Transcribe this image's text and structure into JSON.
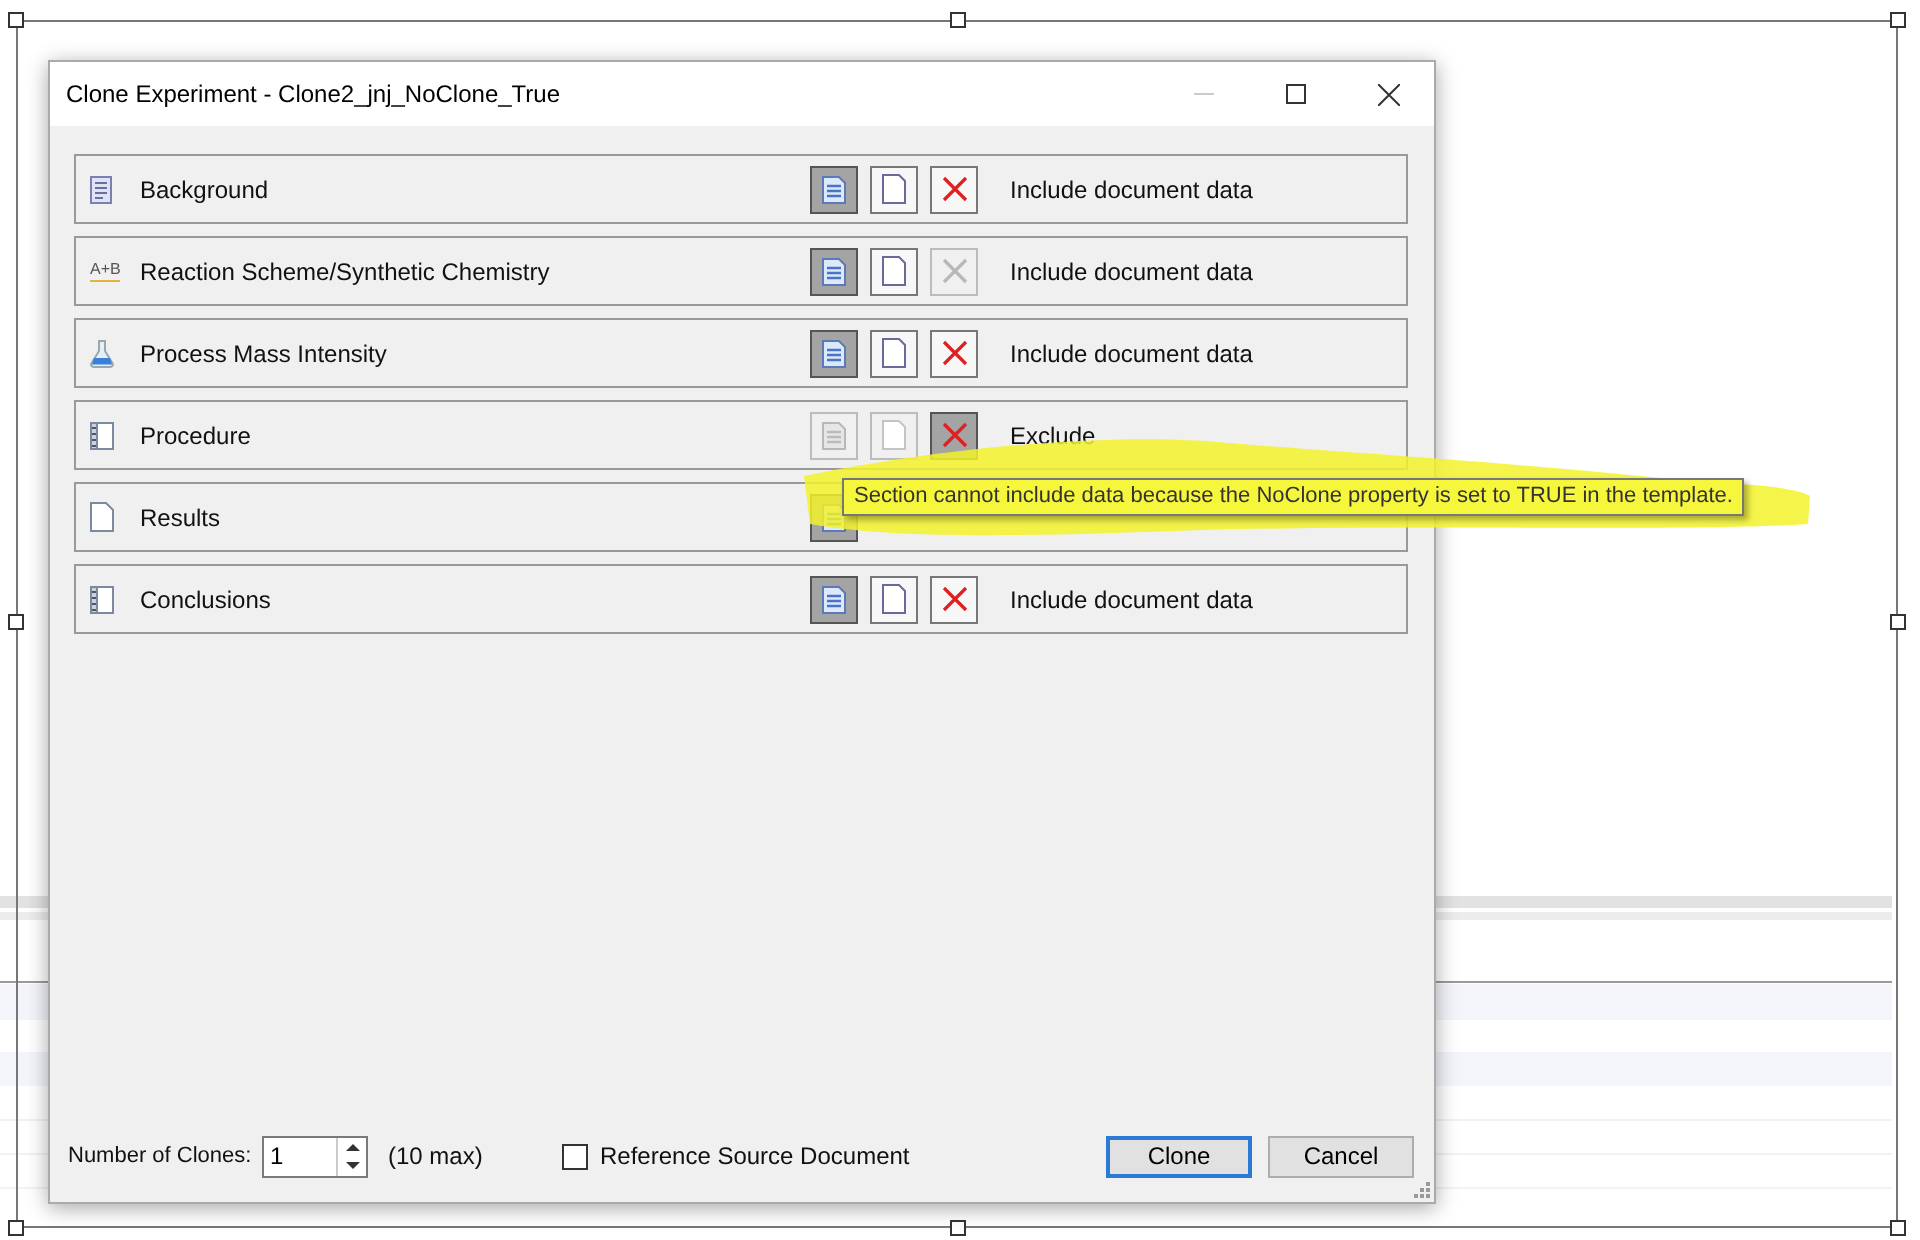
{
  "window": {
    "title": "Clone Experiment - Clone2_jnj_NoClone_True",
    "minimize_disabled": true
  },
  "sections": [
    {
      "name": "Background",
      "kind": "text-page",
      "status": "Include document data",
      "options": [
        {
          "kind": "full",
          "selected": true,
          "disabled": false
        },
        {
          "kind": "blank",
          "selected": false,
          "disabled": false
        },
        {
          "kind": "exclude",
          "selected": false,
          "disabled": false
        }
      ]
    },
    {
      "name": "Reaction Scheme/Synthetic Chemistry",
      "kind": "label",
      "icon_label": "A+B",
      "status": "Include document data",
      "options": [
        {
          "kind": "full",
          "selected": true,
          "disabled": false
        },
        {
          "kind": "blank",
          "selected": false,
          "disabled": false
        },
        {
          "kind": "exclude",
          "selected": false,
          "disabled": true
        }
      ]
    },
    {
      "name": "Process Mass Intensity",
      "kind": "flask",
      "status": "Include document data",
      "options": [
        {
          "kind": "full",
          "selected": true,
          "disabled": false
        },
        {
          "kind": "blank",
          "selected": false,
          "disabled": false
        },
        {
          "kind": "exclude",
          "selected": false,
          "disabled": false
        }
      ]
    },
    {
      "name": "Procedure",
      "kind": "notebook",
      "status": "Exclude",
      "options": [
        {
          "kind": "full",
          "selected": false,
          "disabled": true
        },
        {
          "kind": "blank",
          "selected": false,
          "disabled": true
        },
        {
          "kind": "exclude",
          "selected": true,
          "disabled": false
        }
      ]
    },
    {
      "name": "Results",
      "kind": "blank-page",
      "options": [
        {
          "kind": "full",
          "selected": true,
          "disabled": false
        }
      ]
    },
    {
      "name": "Conclusions",
      "kind": "notebook",
      "status": "Include document data",
      "options": [
        {
          "kind": "full",
          "selected": true,
          "disabled": false
        },
        {
          "kind": "blank",
          "selected": false,
          "disabled": false
        },
        {
          "kind": "exclude",
          "selected": false,
          "disabled": false
        }
      ]
    }
  ],
  "tooltip": "Section cannot include data because the NoClone property is set to TRUE in the template.",
  "footer": {
    "clones_label": "Number of Clones:",
    "clones_value": "1",
    "clones_hint": "(10 max)",
    "reference": {
      "label": "Reference Source Document",
      "checked": false
    },
    "buttons": [
      {
        "label": "Clone",
        "default": true
      },
      {
        "label": "Cancel",
        "default": false
      }
    ]
  }
}
